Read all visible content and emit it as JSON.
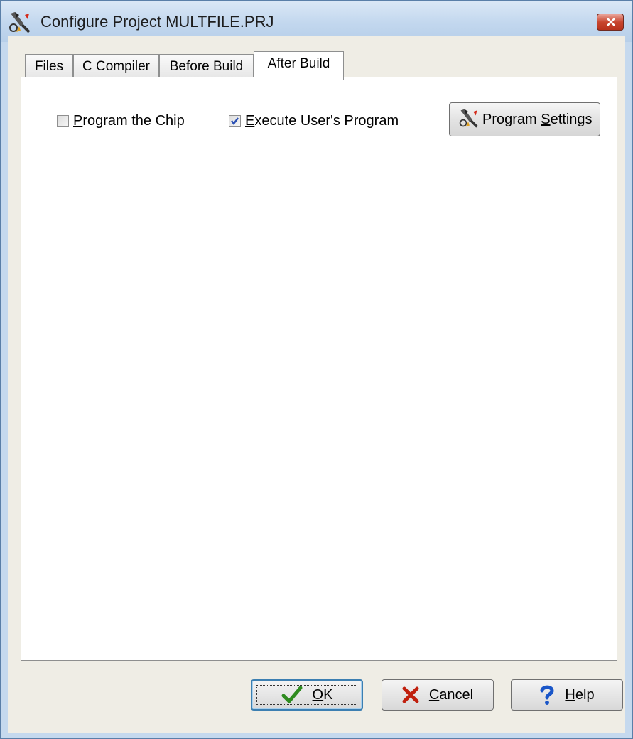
{
  "window": {
    "title": "Configure Project MULTFILE.PRJ",
    "title_icon": "tools-icon",
    "close_icon": "close-icon"
  },
  "tabs": [
    {
      "label": "Files",
      "active": false
    },
    {
      "label": "C Compiler",
      "active": false
    },
    {
      "label": "Before Build",
      "active": false
    },
    {
      "label": "After Build",
      "active": true
    }
  ],
  "after_build": {
    "program_chip": {
      "prefix": "",
      "accel": "P",
      "rest": "rogram the Chip",
      "checked": false
    },
    "execute_program": {
      "prefix": "",
      "accel": "E",
      "rest": "xecute User's Program",
      "checked": true
    },
    "program_settings": {
      "prefix": "Program ",
      "accel": "S",
      "rest": "ettings",
      "icon": "tools-icon"
    }
  },
  "buttons": {
    "ok": {
      "prefix": "",
      "accel": "O",
      "rest": "K",
      "icon": "checkmark-icon"
    },
    "cancel": {
      "prefix": "",
      "accel": "C",
      "rest": "ancel",
      "icon": "x-icon"
    },
    "help": {
      "prefix": "",
      "accel": "H",
      "rest": "elp",
      "icon": "question-icon"
    }
  },
  "colors": {
    "ok_check": "#2e8b1f",
    "cancel_x": "#c0200e",
    "help_q": "#1a56c8",
    "checkbox_mark": "#2a4fb4"
  }
}
